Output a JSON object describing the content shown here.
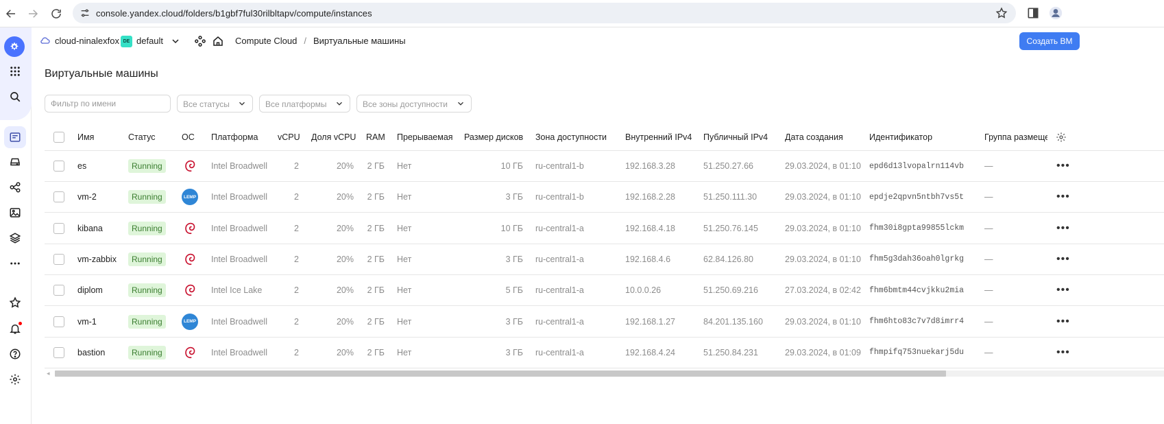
{
  "browser": {
    "url": "console.yandex.cloud/folders/b1gbf7ful30rilbltapv/compute/instances"
  },
  "header": {
    "cloud_name": "cloud-ninalexfox",
    "folder_badge": "DE",
    "folder_name": "default",
    "breadcrumb": [
      "Compute Cloud",
      "Виртуальные машины"
    ],
    "create_button": "Создать ВМ"
  },
  "page": {
    "title": "Виртуальные машины",
    "filter_placeholder": "Фильтр по имени",
    "status_select": "Все статусы",
    "platform_select": "Все платформы",
    "zone_select": "Все зоны доступности"
  },
  "table": {
    "columns": [
      "Имя",
      "Статус",
      "ОС",
      "Платформа",
      "vCPU",
      "Доля vCPU",
      "RAM",
      "Прерываемая",
      "Размер дисков",
      "Зона доступности",
      "Внутренний IPv4",
      "Публичный IPv4",
      "Дата создания",
      "Идентификатор",
      "Группа размеще"
    ],
    "rows": [
      {
        "name": "es",
        "status": "Running",
        "os": "debian",
        "platform": "Intel Broadwell",
        "vcpu": "2",
        "share": "20%",
        "ram": "2 ГБ",
        "preemptible": "Нет",
        "disk": "10 ГБ",
        "zone": "ru-central1-b",
        "ip_int": "192.168.3.28",
        "ip_pub": "51.250.27.66",
        "created": "29.03.2024, в 01:10",
        "id": "epd6d13lvopalrn114vb",
        "group": "—"
      },
      {
        "name": "vm-2",
        "status": "Running",
        "os": "lemp",
        "platform": "Intel Broadwell",
        "vcpu": "2",
        "share": "20%",
        "ram": "2 ГБ",
        "preemptible": "Нет",
        "disk": "3 ГБ",
        "zone": "ru-central1-b",
        "ip_int": "192.168.2.28",
        "ip_pub": "51.250.111.30",
        "created": "29.03.2024, в 01:10",
        "id": "epdje2qpvn5ntbh7vs5t",
        "group": "—"
      },
      {
        "name": "kibana",
        "status": "Running",
        "os": "debian",
        "platform": "Intel Broadwell",
        "vcpu": "2",
        "share": "20%",
        "ram": "2 ГБ",
        "preemptible": "Нет",
        "disk": "10 ГБ",
        "zone": "ru-central1-a",
        "ip_int": "192.168.4.18",
        "ip_pub": "51.250.76.145",
        "created": "29.03.2024, в 01:10",
        "id": "fhm30i8gpta99855lckm",
        "group": "—"
      },
      {
        "name": "vm-zabbix",
        "status": "Running",
        "os": "debian",
        "platform": "Intel Broadwell",
        "vcpu": "2",
        "share": "20%",
        "ram": "2 ГБ",
        "preemptible": "Нет",
        "disk": "3 ГБ",
        "zone": "ru-central1-a",
        "ip_int": "192.168.4.6",
        "ip_pub": "62.84.126.80",
        "created": "29.03.2024, в 01:10",
        "id": "fhm5g3dah36oah0lgrkg",
        "group": "—"
      },
      {
        "name": "diplom",
        "status": "Running",
        "os": "debian",
        "platform": "Intel Ice Lake",
        "vcpu": "2",
        "share": "20%",
        "ram": "2 ГБ",
        "preemptible": "Нет",
        "disk": "5 ГБ",
        "zone": "ru-central1-a",
        "ip_int": "10.0.0.26",
        "ip_pub": "51.250.69.216",
        "created": "27.03.2024, в 02:42",
        "id": "fhm6bmtm44cvjkku2mia",
        "group": "—"
      },
      {
        "name": "vm-1",
        "status": "Running",
        "os": "lemp",
        "platform": "Intel Broadwell",
        "vcpu": "2",
        "share": "20%",
        "ram": "2 ГБ",
        "preemptible": "Нет",
        "disk": "3 ГБ",
        "zone": "ru-central1-a",
        "ip_int": "192.168.1.27",
        "ip_pub": "84.201.135.160",
        "created": "29.03.2024, в 01:10",
        "id": "fhm6hto83c7v7d8imrr4",
        "group": "—"
      },
      {
        "name": "bastion",
        "status": "Running",
        "os": "debian",
        "platform": "Intel Broadwell",
        "vcpu": "2",
        "share": "20%",
        "ram": "2 ГБ",
        "preemptible": "Нет",
        "disk": "3 ГБ",
        "zone": "ru-central1-a",
        "ip_int": "192.168.4.24",
        "ip_pub": "51.250.84.231",
        "created": "29.03.2024, в 01:09",
        "id": "fhmpifq753nuekarj5du",
        "group": "—"
      }
    ]
  },
  "icons": {
    "lemp_label": "LEMP",
    "status_color": "#3a7d2f",
    "accent": "#3f7cf2"
  }
}
